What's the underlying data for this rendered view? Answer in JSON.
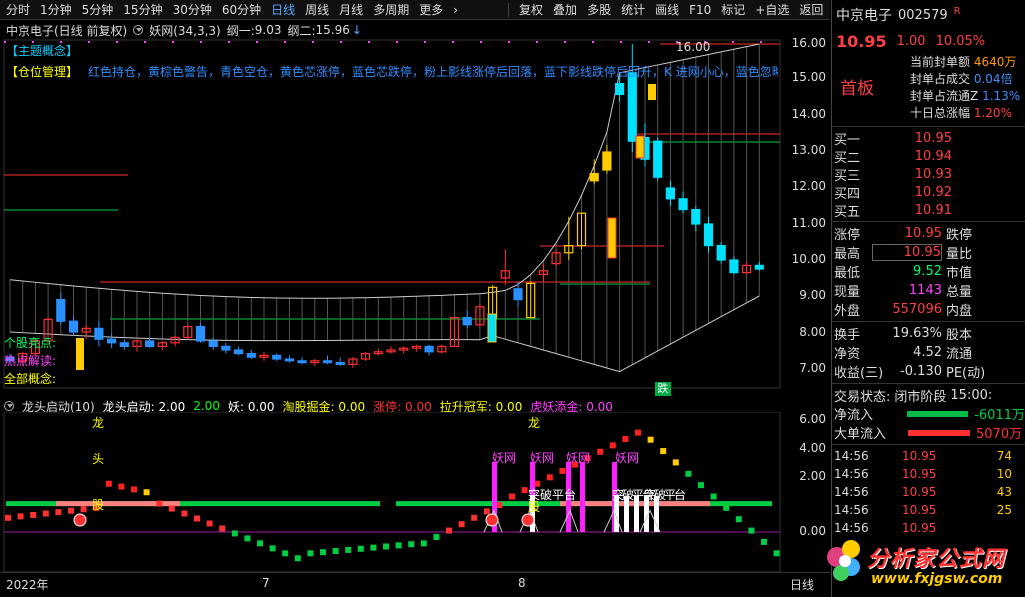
{
  "toolbar": {
    "items": [
      "分时",
      "1分钟",
      "5分钟",
      "15分钟",
      "30分钟",
      "60分钟",
      "日线",
      "周线",
      "月线",
      "多周期",
      "更多"
    ],
    "active": "日线",
    "right_items": [
      "复权",
      "叠加",
      "多股",
      "统计",
      "画线",
      "F10",
      "标记",
      "+自选",
      "返回"
    ]
  },
  "infoline": {
    "stock": "中京电子(日线 前复权)",
    "indicator": "妖网(34,3,3)",
    "v1_label": "纲一:",
    "v1": "9.03",
    "v2_label": "纲二:",
    "v2": "15.96",
    "v2_arrow": "↓"
  },
  "topics": {
    "theme": "【主题概念】",
    "position": "【仓位管理】",
    "position_text": "红色持仓，黄棕色警告，青色空仓，黄色芯涨停，蓝色芯跌停，粉上影线涨停后回落，蓝下影线跌停后回升，K  进网小心，蓝色忽略",
    "stock_hl": "个股亮点:",
    "hot": "热点解读:",
    "all": "全部概念:"
  },
  "price_axis": [
    "16.00",
    "15.00",
    "14.00",
    "13.00",
    "12.00",
    "11.00",
    "10.00",
    "9.00",
    "8.00",
    "7.00"
  ],
  "annotations": {
    "peak": "16.00",
    "fall": "跌"
  },
  "indicator": {
    "name": "龙头启动(10)",
    "items": [
      {
        "label": "龙头启动:",
        "value": "2.00",
        "color": "#ffffff"
      },
      {
        "label": "",
        "value": "2.00",
        "color": "#00ff00"
      },
      {
        "label": "妖:",
        "value": "0.00",
        "color": "#ffffff"
      },
      {
        "label": "淘股掘金:",
        "value": "0.00",
        "color": "#ffff00"
      },
      {
        "label": "涨停:",
        "value": "0.00",
        "color": "#ff3030"
      },
      {
        "label": "拉升冠军:",
        "value": "0.00",
        "color": "#ffff00"
      },
      {
        "label": "虎妖添金:",
        "value": "0.00",
        "color": "#ff40ff"
      }
    ],
    "axis": [
      "6.00",
      "4.00",
      "2.00",
      "0.00"
    ],
    "marks": {
      "tou": "头",
      "gu": "股",
      "long": "龙",
      "yao": "妖网",
      "gu2": "股",
      "platform": "突破平台",
      "multi": "突破平台"
    }
  },
  "date_axis": {
    "labels": [
      "2022年",
      "7",
      "8"
    ],
    "period": "日线"
  },
  "right": {
    "name": "中京电子",
    "code": "002579",
    "flag": "R",
    "price": "10.95",
    "change": "1.00",
    "pct": "10.05%",
    "board": "首板",
    "seal": [
      {
        "k": "当前封单额",
        "v": "4640万"
      },
      {
        "k": "封单占成交",
        "v": "0.04倍"
      },
      {
        "k": "封单占流通Z",
        "v": "1.13%"
      },
      {
        "k": "十日总涨幅",
        "v": "1.20%"
      }
    ],
    "orderbook": [
      {
        "label": "买一",
        "price": "10.95"
      },
      {
        "label": "买二",
        "price": "10.94"
      },
      {
        "label": "买三",
        "price": "10.93"
      },
      {
        "label": "买四",
        "price": "10.92"
      },
      {
        "label": "买五",
        "price": "10.91"
      }
    ],
    "quote": [
      {
        "k": "涨停",
        "v": "10.95",
        "vc": "#ff4040",
        "k2": "跌停"
      },
      {
        "k": "最高",
        "v": "10.95",
        "vc": "#ff4040",
        "k2": "量比"
      },
      {
        "k": "最低",
        "v": "9.52",
        "vc": "#00ff66",
        "k2": "市值"
      },
      {
        "k": "现量",
        "v": "1143",
        "vc": "#ff40ff",
        "k2": "总量"
      },
      {
        "k": "外盘",
        "v": "557096",
        "vc": "#ff4040",
        "k2": "内盘"
      }
    ],
    "quote2": [
      {
        "k": "换手",
        "v": "19.63%",
        "k2": "股本"
      },
      {
        "k": "净资",
        "v": "4.52",
        "k2": "流通"
      },
      {
        "k": "收益(三)",
        "v": "-0.130",
        "k2": "PE(动)"
      }
    ],
    "trade_state_label": "交易状态:",
    "trade_state": "闭市阶段",
    "trade_time": "15:00:",
    "flows": [
      {
        "k": "净流入",
        "v": "-6011万",
        "c": "#00cc44"
      },
      {
        "k": "大单流入",
        "v": "5070万",
        "c": "#ff3030"
      }
    ],
    "ticks": [
      {
        "t": "14:56",
        "p": "10.95",
        "v": "74"
      },
      {
        "t": "14:56",
        "p": "10.95",
        "v": "10"
      },
      {
        "t": "14:56",
        "p": "10.95",
        "v": "43"
      },
      {
        "t": "14:56",
        "p": "10.95",
        "v": "25"
      },
      {
        "t": "14:56",
        "p": "10.95",
        "v": ""
      }
    ],
    "watermark": "分析家公式网",
    "watermark_url": "www.fxjgsw.com"
  },
  "chart_data": {
    "type": "candlestick",
    "ylim": [
      6.5,
      16.3
    ],
    "candles": [
      [
        7.3,
        7.4,
        7.1,
        7.2
      ],
      [
        7.2,
        7.45,
        7.05,
        7.4
      ],
      [
        7.4,
        7.8,
        7.35,
        7.75
      ],
      [
        7.75,
        8.4,
        7.7,
        8.35
      ],
      [
        8.9,
        9.1,
        8.2,
        8.3
      ],
      [
        8.3,
        8.45,
        7.9,
        8.0
      ],
      [
        8.0,
        8.2,
        7.8,
        8.1
      ],
      [
        8.1,
        8.3,
        7.6,
        7.8
      ],
      [
        7.8,
        7.95,
        7.55,
        7.7
      ],
      [
        7.7,
        7.8,
        7.5,
        7.6
      ],
      [
        7.6,
        7.8,
        7.45,
        7.75
      ],
      [
        7.75,
        7.85,
        7.55,
        7.6
      ],
      [
        7.6,
        7.75,
        7.5,
        7.7
      ],
      [
        7.7,
        7.9,
        7.6,
        7.85
      ],
      [
        7.85,
        8.2,
        7.8,
        8.15
      ],
      [
        8.15,
        8.25,
        7.7,
        7.75
      ],
      [
        7.75,
        7.85,
        7.5,
        7.6
      ],
      [
        7.6,
        7.7,
        7.4,
        7.5
      ],
      [
        7.5,
        7.6,
        7.35,
        7.4
      ],
      [
        7.4,
        7.5,
        7.25,
        7.3
      ],
      [
        7.3,
        7.45,
        7.2,
        7.35
      ],
      [
        7.35,
        7.4,
        7.2,
        7.25
      ],
      [
        7.25,
        7.35,
        7.15,
        7.2
      ],
      [
        7.2,
        7.3,
        7.1,
        7.15
      ],
      [
        7.15,
        7.25,
        7.05,
        7.2
      ],
      [
        7.2,
        7.35,
        7.1,
        7.15
      ],
      [
        7.15,
        7.3,
        7.05,
        7.1
      ],
      [
        7.1,
        7.3,
        7.0,
        7.25
      ],
      [
        7.25,
        7.45,
        7.2,
        7.4
      ],
      [
        7.4,
        7.55,
        7.35,
        7.45
      ],
      [
        7.45,
        7.6,
        7.4,
        7.5
      ],
      [
        7.5,
        7.6,
        7.4,
        7.55
      ],
      [
        7.55,
        7.65,
        7.45,
        7.6
      ],
      [
        7.6,
        7.65,
        7.35,
        7.45
      ],
      [
        7.45,
        7.65,
        7.4,
        7.6
      ],
      [
        7.6,
        8.4,
        7.6,
        8.4
      ],
      [
        8.4,
        8.6,
        8.1,
        8.2
      ],
      [
        8.2,
        8.8,
        8.15,
        8.7
      ],
      [
        8.4,
        9.3,
        8.3,
        9.24
      ],
      [
        9.5,
        10.3,
        9.3,
        9.7
      ],
      [
        9.2,
        9.4,
        8.7,
        8.9
      ],
      [
        8.4,
        9.4,
        8.4,
        9.35
      ],
      [
        9.6,
        9.9,
        9.4,
        9.7
      ],
      [
        9.9,
        10.3,
        9.8,
        10.2
      ],
      [
        10.2,
        11.2,
        10.0,
        10.4
      ],
      [
        10.4,
        11.3,
        10.3,
        11.3
      ],
      [
        12.4,
        12.8,
        12.1,
        12.2
      ],
      [
        13.0,
        13.2,
        12.4,
        12.5
      ],
      [
        14.9,
        15.1,
        14.4,
        14.6
      ],
      [
        15.2,
        16.0,
        13.0,
        13.3
      ],
      [
        13.4,
        13.8,
        12.6,
        12.8
      ],
      [
        13.3,
        13.4,
        12.2,
        12.3
      ],
      [
        12.0,
        12.2,
        11.5,
        11.7
      ],
      [
        11.7,
        11.9,
        11.3,
        11.4
      ],
      [
        11.4,
        11.5,
        10.8,
        11.0
      ],
      [
        11.0,
        11.2,
        10.2,
        10.4
      ],
      [
        10.4,
        10.5,
        9.9,
        10.0
      ],
      [
        10.0,
        10.1,
        9.6,
        9.65
      ],
      [
        9.65,
        9.95,
        9.6,
        9.85
      ],
      [
        9.85,
        9.95,
        9.7,
        9.75
      ]
    ]
  }
}
